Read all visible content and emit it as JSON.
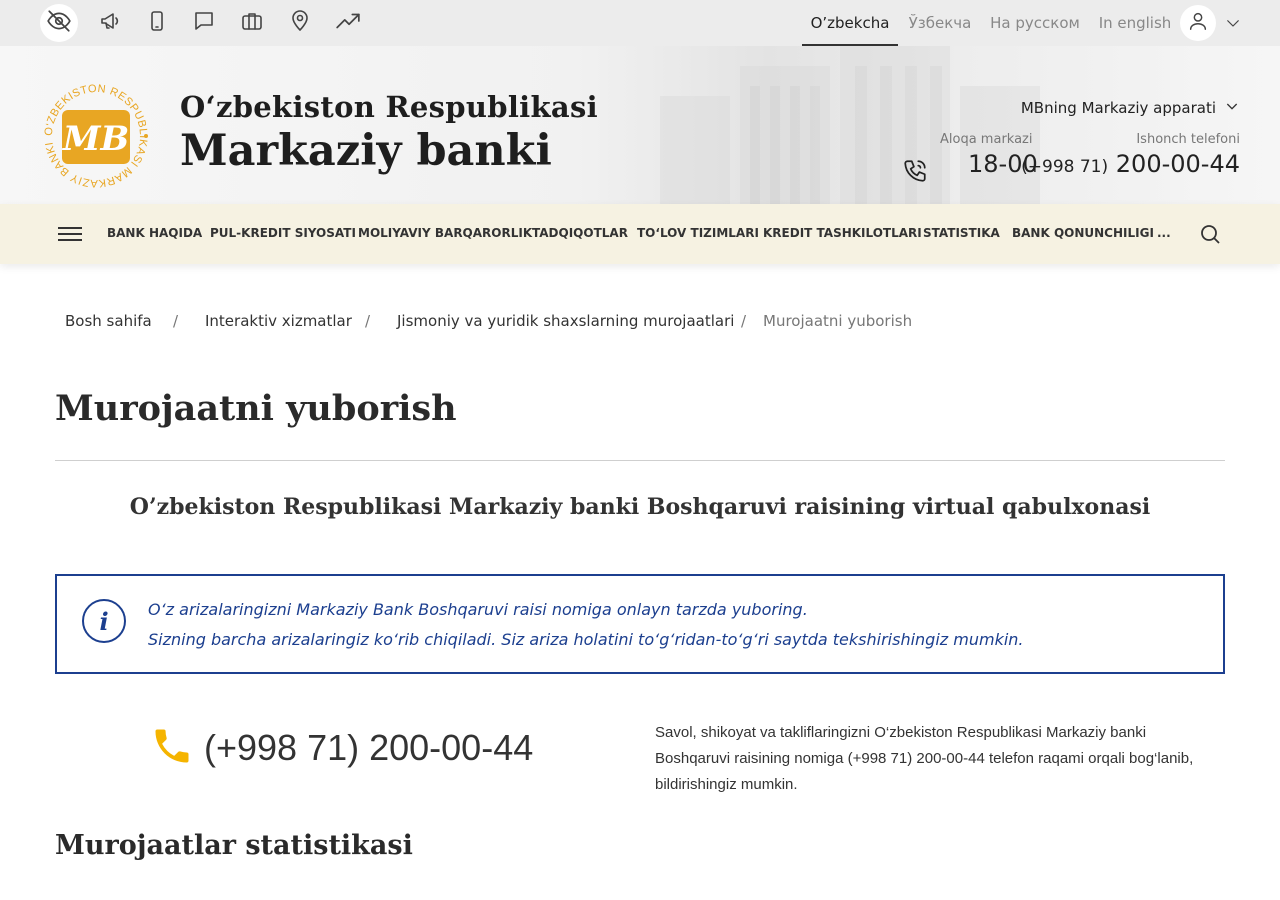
{
  "languages": [
    {
      "label": "O’zbekcha",
      "active": true
    },
    {
      "label": "Ўзбекча",
      "active": false
    },
    {
      "label": "На русском",
      "active": false
    },
    {
      "label": "In english",
      "active": false
    }
  ],
  "topbar_icons": [
    "eye-off-icon",
    "megaphone-icon",
    "mobile-icon",
    "chat-icon",
    "briefcase-icon",
    "map-pin-icon",
    "trending-up-icon",
    "user-icon",
    "chevron-down-icon"
  ],
  "header": {
    "title_line1": "O‘zbekiston Respublikasi",
    "title_line2": "Markaziy banki",
    "logo_ring_text": "O‘ZBEKISTON RESPUBLIKASI MARKAZIY BANKI",
    "logo_letters": "MB",
    "apparat_label": "MBning Markaziy apparati",
    "contact_center_label": "Aloqa markazi",
    "contact_center_number": "18-00",
    "trust_phone_label": "Ishonch telefoni",
    "trust_phone_prefix": "(+998 71)",
    "trust_phone_number": "200-00-44"
  },
  "nav": {
    "items": [
      "BANK HAQIDA",
      "PUL-KREDIT SIYOSATI",
      "MOLIYAVIY BARQARORLIK",
      "TADQIQOTLAR",
      "TO‘LOV TIZIMLARI",
      "KREDIT TASHKILOTLARI",
      "STATISTIKA",
      "BANK QONUNCHILIGI",
      "..."
    ]
  },
  "breadcrumb": {
    "items": [
      "Bosh sahifa",
      "Interaktiv xizmatlar",
      "Jismoniy va yuridik shaxslarning murojaatlari",
      "Murojaatni yuborish"
    ],
    "separator": "/"
  },
  "page": {
    "title": "Murojaatni yuborish",
    "subtitle": "O’zbekiston Respublikasi Markaziy banki Boshqaruvi raisining virtual qabulxonasi",
    "info_line1": "O‘z arizalaringizni Markaziy Bank Boshqaruvi raisi nomiga onlayn tarzda yuboring.",
    "info_line2": "Sizning barcha arizalaringiz ko‘rib chiqiladi. Siz ariza holatini to‘g‘ridan-to‘g‘ri saytda tekshirishingiz mumkin.",
    "phone": "(+998 71) 200-00-44",
    "phone_description": "Savol, shikoyat va takliflaringizni O‘zbekiston Respublikasi Markaziy banki Boshqaruvi raisining nomiga (+998 71) 200-00-44 telefon raqami orqali bog‘lanib, bildirishingiz mumkin.",
    "stats_title": "Murojaatlar statistikasi"
  },
  "colors": {
    "gold": "#e8a623",
    "info_blue": "#1c3f8f",
    "phone_yellow": "#f5b400",
    "nav_bg": "#f6f2e2"
  }
}
